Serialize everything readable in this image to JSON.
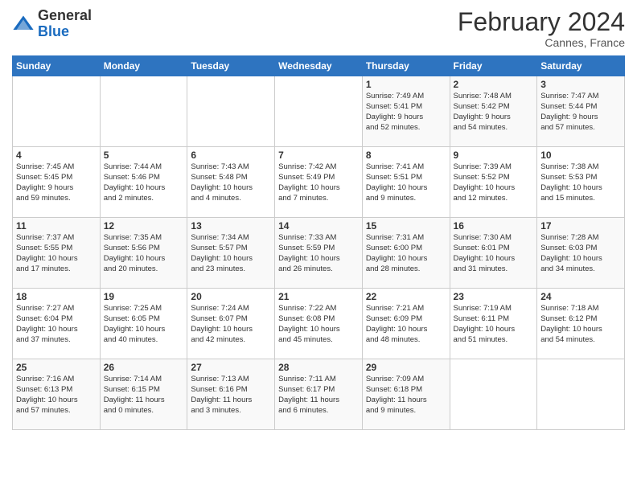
{
  "header": {
    "logo_general": "General",
    "logo_blue": "Blue",
    "month_title": "February 2024",
    "subtitle": "Cannes, France"
  },
  "weekdays": [
    "Sunday",
    "Monday",
    "Tuesday",
    "Wednesday",
    "Thursday",
    "Friday",
    "Saturday"
  ],
  "weeks": [
    [
      {
        "day": "",
        "info": ""
      },
      {
        "day": "",
        "info": ""
      },
      {
        "day": "",
        "info": ""
      },
      {
        "day": "",
        "info": ""
      },
      {
        "day": "1",
        "info": "Sunrise: 7:49 AM\nSunset: 5:41 PM\nDaylight: 9 hours\nand 52 minutes."
      },
      {
        "day": "2",
        "info": "Sunrise: 7:48 AM\nSunset: 5:42 PM\nDaylight: 9 hours\nand 54 minutes."
      },
      {
        "day": "3",
        "info": "Sunrise: 7:47 AM\nSunset: 5:44 PM\nDaylight: 9 hours\nand 57 minutes."
      }
    ],
    [
      {
        "day": "4",
        "info": "Sunrise: 7:45 AM\nSunset: 5:45 PM\nDaylight: 9 hours\nand 59 minutes."
      },
      {
        "day": "5",
        "info": "Sunrise: 7:44 AM\nSunset: 5:46 PM\nDaylight: 10 hours\nand 2 minutes."
      },
      {
        "day": "6",
        "info": "Sunrise: 7:43 AM\nSunset: 5:48 PM\nDaylight: 10 hours\nand 4 minutes."
      },
      {
        "day": "7",
        "info": "Sunrise: 7:42 AM\nSunset: 5:49 PM\nDaylight: 10 hours\nand 7 minutes."
      },
      {
        "day": "8",
        "info": "Sunrise: 7:41 AM\nSunset: 5:51 PM\nDaylight: 10 hours\nand 9 minutes."
      },
      {
        "day": "9",
        "info": "Sunrise: 7:39 AM\nSunset: 5:52 PM\nDaylight: 10 hours\nand 12 minutes."
      },
      {
        "day": "10",
        "info": "Sunrise: 7:38 AM\nSunset: 5:53 PM\nDaylight: 10 hours\nand 15 minutes."
      }
    ],
    [
      {
        "day": "11",
        "info": "Sunrise: 7:37 AM\nSunset: 5:55 PM\nDaylight: 10 hours\nand 17 minutes."
      },
      {
        "day": "12",
        "info": "Sunrise: 7:35 AM\nSunset: 5:56 PM\nDaylight: 10 hours\nand 20 minutes."
      },
      {
        "day": "13",
        "info": "Sunrise: 7:34 AM\nSunset: 5:57 PM\nDaylight: 10 hours\nand 23 minutes."
      },
      {
        "day": "14",
        "info": "Sunrise: 7:33 AM\nSunset: 5:59 PM\nDaylight: 10 hours\nand 26 minutes."
      },
      {
        "day": "15",
        "info": "Sunrise: 7:31 AM\nSunset: 6:00 PM\nDaylight: 10 hours\nand 28 minutes."
      },
      {
        "day": "16",
        "info": "Sunrise: 7:30 AM\nSunset: 6:01 PM\nDaylight: 10 hours\nand 31 minutes."
      },
      {
        "day": "17",
        "info": "Sunrise: 7:28 AM\nSunset: 6:03 PM\nDaylight: 10 hours\nand 34 minutes."
      }
    ],
    [
      {
        "day": "18",
        "info": "Sunrise: 7:27 AM\nSunset: 6:04 PM\nDaylight: 10 hours\nand 37 minutes."
      },
      {
        "day": "19",
        "info": "Sunrise: 7:25 AM\nSunset: 6:05 PM\nDaylight: 10 hours\nand 40 minutes."
      },
      {
        "day": "20",
        "info": "Sunrise: 7:24 AM\nSunset: 6:07 PM\nDaylight: 10 hours\nand 42 minutes."
      },
      {
        "day": "21",
        "info": "Sunrise: 7:22 AM\nSunset: 6:08 PM\nDaylight: 10 hours\nand 45 minutes."
      },
      {
        "day": "22",
        "info": "Sunrise: 7:21 AM\nSunset: 6:09 PM\nDaylight: 10 hours\nand 48 minutes."
      },
      {
        "day": "23",
        "info": "Sunrise: 7:19 AM\nSunset: 6:11 PM\nDaylight: 10 hours\nand 51 minutes."
      },
      {
        "day": "24",
        "info": "Sunrise: 7:18 AM\nSunset: 6:12 PM\nDaylight: 10 hours\nand 54 minutes."
      }
    ],
    [
      {
        "day": "25",
        "info": "Sunrise: 7:16 AM\nSunset: 6:13 PM\nDaylight: 10 hours\nand 57 minutes."
      },
      {
        "day": "26",
        "info": "Sunrise: 7:14 AM\nSunset: 6:15 PM\nDaylight: 11 hours\nand 0 minutes."
      },
      {
        "day": "27",
        "info": "Sunrise: 7:13 AM\nSunset: 6:16 PM\nDaylight: 11 hours\nand 3 minutes."
      },
      {
        "day": "28",
        "info": "Sunrise: 7:11 AM\nSunset: 6:17 PM\nDaylight: 11 hours\nand 6 minutes."
      },
      {
        "day": "29",
        "info": "Sunrise: 7:09 AM\nSunset: 6:18 PM\nDaylight: 11 hours\nand 9 minutes."
      },
      {
        "day": "",
        "info": ""
      },
      {
        "day": "",
        "info": ""
      }
    ]
  ]
}
